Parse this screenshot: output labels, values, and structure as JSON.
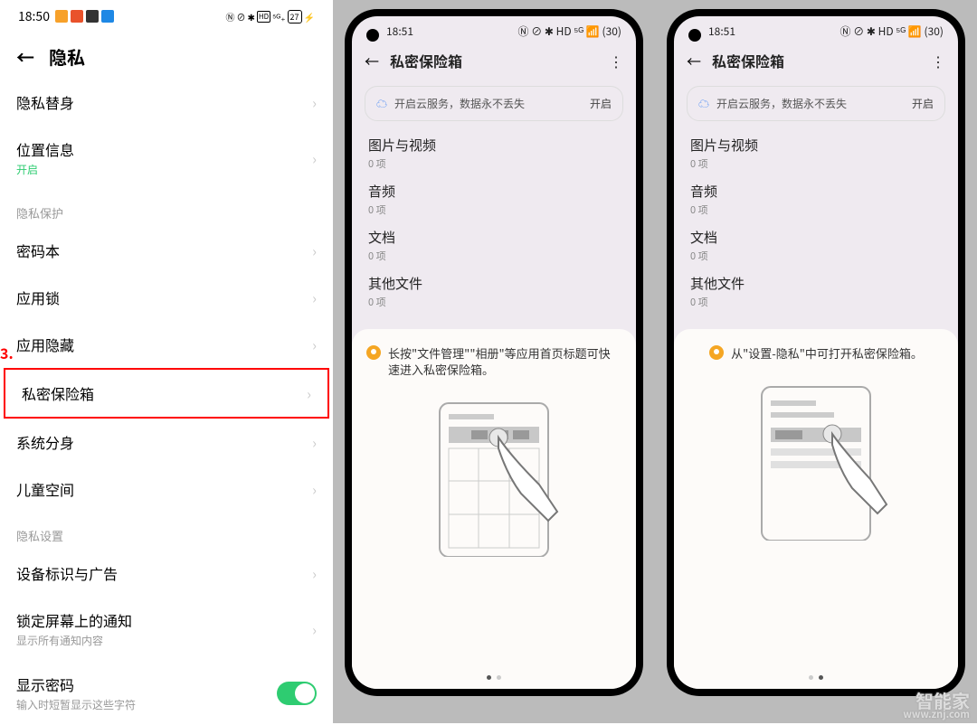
{
  "left": {
    "time": "18:50",
    "battery": "27",
    "title": "隐私",
    "step_label": "3.",
    "rows": [
      {
        "title": "隐私替身",
        "sub": ""
      },
      {
        "title": "位置信息",
        "sub": "开启",
        "sub_green": true
      }
    ],
    "sec1": "隐私保护",
    "sec1_rows": [
      {
        "title": "密码本"
      },
      {
        "title": "应用锁"
      },
      {
        "title": "应用隐藏"
      },
      {
        "title": "私密保险箱",
        "highlight": true
      },
      {
        "title": "系统分身"
      },
      {
        "title": "儿童空间"
      }
    ],
    "sec2": "隐私设置",
    "sec2_rows": [
      {
        "title": "设备标识与广告"
      },
      {
        "title": "锁定屏幕上的通知",
        "sub": "显示所有通知内容"
      },
      {
        "title": "显示密码",
        "sub": "输入时短暂显示这些字符",
        "toggle": true
      }
    ]
  },
  "phones": [
    {
      "time": "18:51",
      "title": "私密保险箱",
      "cloud_text": "开启云服务，数据永不丢失",
      "cloud_action": "开启",
      "categories": [
        {
          "t": "图片与视频",
          "c": "0 项"
        },
        {
          "t": "音频",
          "c": "0 项"
        },
        {
          "t": "文档",
          "c": "0 项"
        },
        {
          "t": "其他文件",
          "c": "0 项"
        }
      ],
      "tip": "长按\"文件管理\"\"相册\"等应用首页标题可快速进入私密保险箱。",
      "page_active": 0
    },
    {
      "time": "18:51",
      "title": "私密保险箱",
      "cloud_text": "开启云服务，数据永不丢失",
      "cloud_action": "开启",
      "categories": [
        {
          "t": "图片与视频",
          "c": "0 项"
        },
        {
          "t": "音频",
          "c": "0 项"
        },
        {
          "t": "文档",
          "c": "0 项"
        },
        {
          "t": "其他文件",
          "c": "0 项"
        }
      ],
      "tip": "从\"设置-隐私\"中可打开私密保险箱。",
      "page_active": 1
    }
  ],
  "watermark": {
    "brand": "智能家",
    "url": "www.znj.com"
  }
}
